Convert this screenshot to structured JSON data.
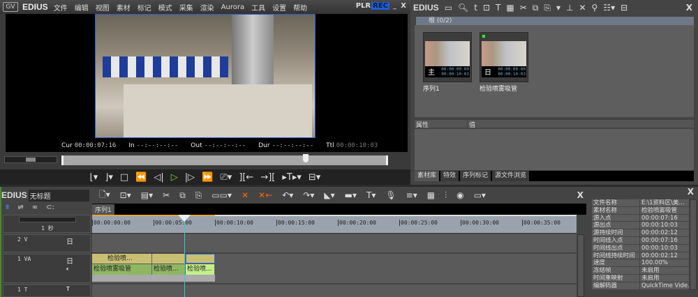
{
  "menubar": {
    "logo": "GV",
    "brand": "EDIUS",
    "items": [
      "文件",
      "编辑",
      "视图",
      "素材",
      "标记",
      "模式",
      "采集",
      "渲染",
      "Aurora",
      "工具",
      "设置",
      "帮助"
    ],
    "plr": "PLR",
    "rec": "REC",
    "minimize": "_",
    "close": "X"
  },
  "player": {
    "cur_label": "Cur",
    "cur": "00:00:07:16",
    "in_label": "In",
    "in": "--:--:--:--",
    "out_label": "Out",
    "out": "--:--:--:--",
    "dur_label": "Dur",
    "dur": "--:--:--:--",
    "ttl_label": "Ttl",
    "ttl": "00:00:10:03",
    "playhead_percent": 75
  },
  "bin": {
    "brand": "EDIUS",
    "close": "X",
    "folder": "根 (0/2)",
    "clips": [
      {
        "name": "序列1",
        "icon": "主",
        "tc_in": "00:00:00:00",
        "tc_out": "00:00:10:03"
      },
      {
        "name": "检验喷雾吸管",
        "icon": "日",
        "tc_in": "00:00:00:00",
        "tc_out": "00:00:10:03"
      }
    ],
    "prop_headers": [
      "属性",
      "值"
    ],
    "tabs": [
      "素材库",
      "特效",
      "序列标记",
      "源文件浏览"
    ]
  },
  "timeline": {
    "brand": "EDIUS",
    "project": "无标题",
    "sequence_tab": "序列1",
    "scale": "1 秒",
    "ruler": [
      "00:00:00:00",
      "00:00:05:00",
      "00:00:10:00",
      "00:00:15:00",
      "00:00:20:00",
      "00:00:25:00",
      "00:00:30:00",
      "00:00:35:00"
    ],
    "tracks": {
      "v2": "2 V",
      "va1": "1 VA",
      "t1": "1 T"
    },
    "clips": {
      "v": [
        "检验喷...",
        "",
        ""
      ],
      "v3": "检验喷...",
      "a": [
        "检验喷雾吸管",
        "检验喷...",
        "检验喷..."
      ]
    }
  },
  "info": {
    "close": "X",
    "rows": [
      [
        "文件名称",
        "E:\\1资料区\\美..."
      ],
      [
        "素材名称",
        "检验喷雾吸管"
      ],
      [
        "源入点",
        "00:00:07:16"
      ],
      [
        "源出点",
        "00:00:10:03"
      ],
      [
        "源持续时间",
        "00:00:02:12"
      ],
      [
        "时间线入点",
        "00:00:07:16"
      ],
      [
        "时间线出点",
        "00:00:10:03"
      ],
      [
        "时间线持续时间",
        "00:00:02:12"
      ],
      [
        "速度",
        "100.00%"
      ],
      [
        "冻结帧",
        "未启用"
      ],
      [
        "时间重映射",
        "未启用"
      ],
      [
        "编解码器",
        "QuickTime Vide..."
      ]
    ]
  }
}
